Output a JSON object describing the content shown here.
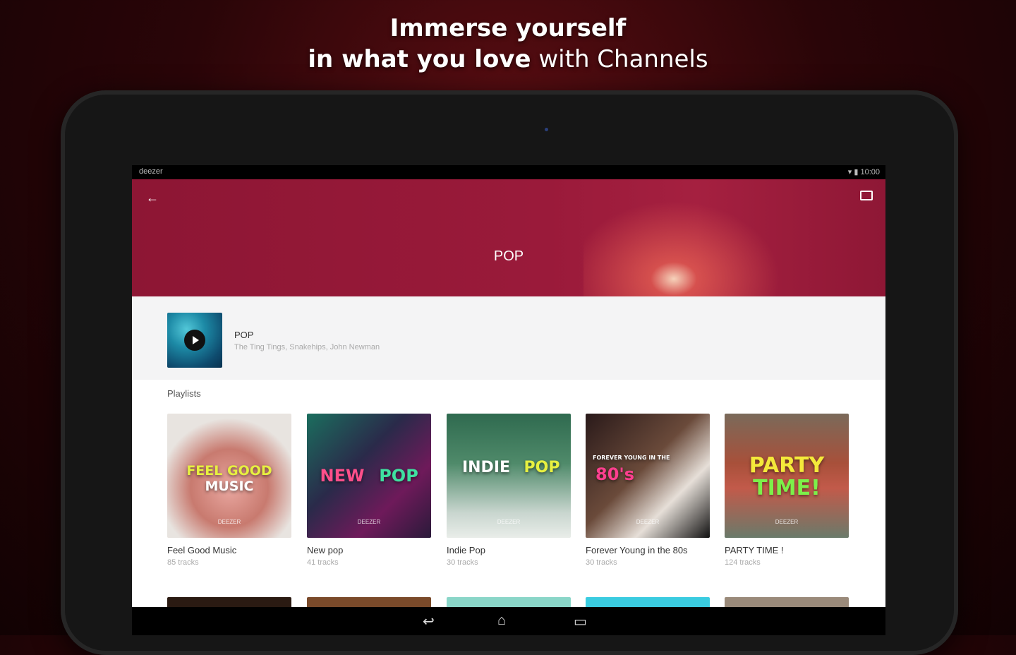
{
  "promo": {
    "line1": "Immerse yourself",
    "line2_bold": "in what you love",
    "line2_light": " with Channels"
  },
  "statusbar": {
    "app": "deezer",
    "time": "10:00"
  },
  "hero": {
    "back_icon": "arrow-left-icon",
    "cast_icon": "cast-icon",
    "title": "POP",
    "color": "#9a1a3a"
  },
  "flow": {
    "name": "POP",
    "artists": "The Ting Tings, Snakehips, John Newman"
  },
  "playlists": {
    "label": "Playlists",
    "items": [
      {
        "title": "Feel Good Music",
        "tracks": "85 tracks",
        "art_line1": "FEEL GOOD",
        "art_line2": "MUSIC",
        "brand": "DEEZER"
      },
      {
        "title": "New pop",
        "tracks": "41 tracks",
        "art_line1": "NEW",
        "art_line2": "POP",
        "brand": "DEEZER"
      },
      {
        "title": "Indie Pop",
        "tracks": "30 tracks",
        "art_line1": "INDIE",
        "art_line2": "POP",
        "brand": "DEEZER"
      },
      {
        "title": "Forever Young in the 80s",
        "tracks": "30 tracks",
        "art_line1": "FOREVER YOUNG IN THE",
        "art_line2": "80's",
        "brand": "DEEZER"
      },
      {
        "title": "PARTY TIME !",
        "tracks": "124 tracks",
        "art_line1": "PARTY",
        "art_line2": "TIME!",
        "brand": "DEEZER"
      }
    ]
  },
  "navbar": {
    "back": "back-icon",
    "home": "home-icon",
    "recents": "recents-icon"
  }
}
